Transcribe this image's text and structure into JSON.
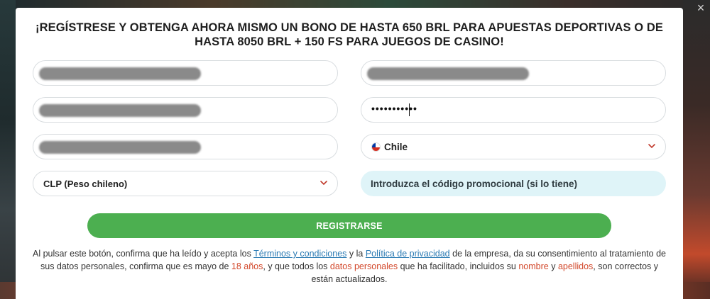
{
  "window": {
    "close_glyph": "×"
  },
  "headline": "¡REGÍSTRESE Y OBTENGA AHORA MISMO UN BONO DE HASTA 650 BRL PARA APUESTAS DEPORTIVAS O DE HASTA 8050 BRL + 150 FS PARA JUEGOS DE CASINO!",
  "form": {
    "password_masked": "•••••••••••",
    "country_selected": "Chile",
    "currency_selected": "CLP (Peso chileno)",
    "promo_placeholder": "Introduzca el código promocional (si lo tiene)",
    "register_label": "REGISTRARSE"
  },
  "legal": {
    "p1": "Al pulsar este botón, confirma que ha leído y acepta los ",
    "terms_link": "Términos y condiciones",
    "p2": " y la ",
    "privacy_link": "Política de privacidad",
    "p3": " de la empresa, da su consentimiento al tratamiento de sus datos personales, confirma que es mayo de ",
    "age": "18 años",
    "p4": ", y que todos los ",
    "personal_data": "datos personales",
    "p5": " que ha facilitado, incluidos su ",
    "name": "nombre",
    "p6": " y ",
    "surname": "apellidos",
    "p7": ", son correctos y están actualizados."
  },
  "colors": {
    "accent_green": "#4caf50",
    "link_blue": "#2a7ab3",
    "highlight_red": "#d2472a",
    "promo_bg": "#dff4f8"
  },
  "icons": {
    "select_chevron": "chevron-down-icon",
    "country_flag": "chile-flag-icon",
    "close": "close-icon"
  }
}
